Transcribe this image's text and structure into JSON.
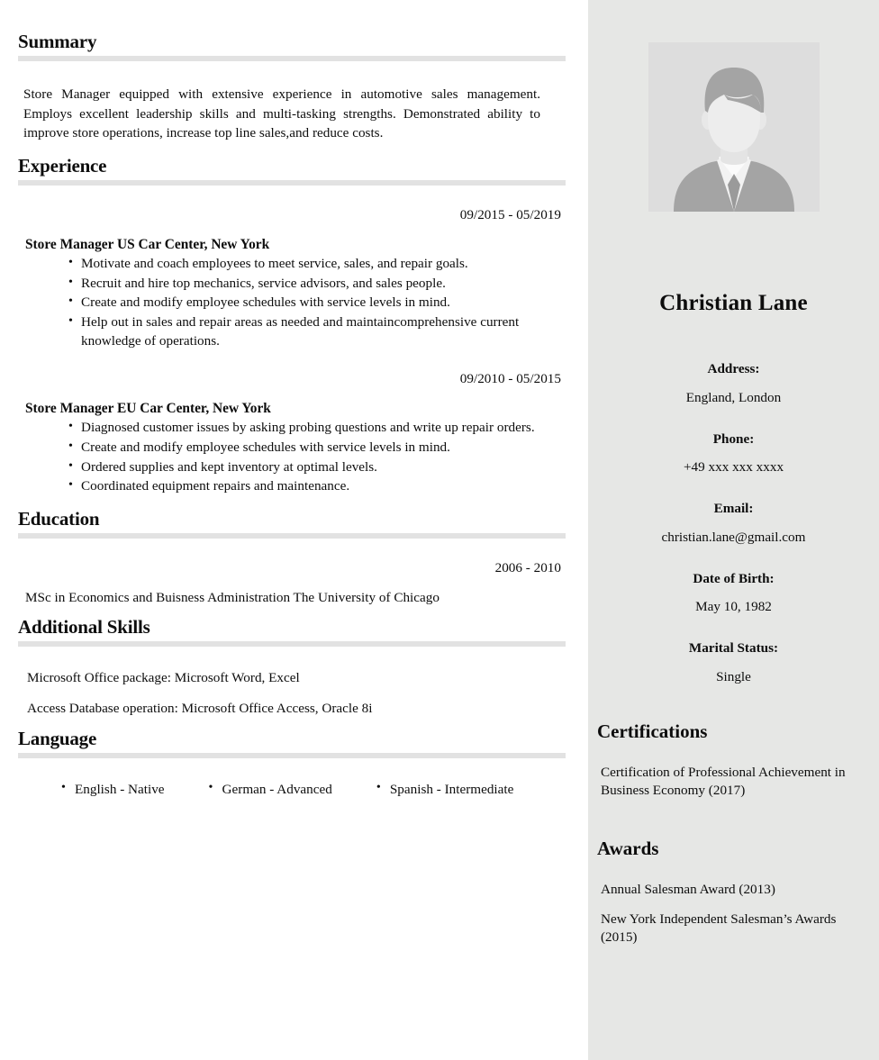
{
  "document": {
    "type": "resume",
    "colors": {
      "page_background": "#ffffff",
      "sidebar_background": "#e6e7e5",
      "rule": "#e2e2e2",
      "text": "#0d0d0d",
      "photo_background": "#dddddd",
      "photo_silhouette": "#a4a4a4",
      "photo_face": "#ededed"
    }
  },
  "main": {
    "summary": {
      "heading": "Summary",
      "text": "Store Manager equipped with extensive experience in automotive sales management. Employs excellent leadership skills and multi-tasking strengths. Demonstrated ability to improve store operations, increase top line sales,and reduce costs."
    },
    "experience": {
      "heading": "Experience",
      "jobs": [
        {
          "dates": "09/2015 - 05/2019",
          "title": "Store Manager US Car Center, New York",
          "bullets": [
            "Motivate and coach employees to meet service, sales, and repair goals.",
            "Recruit and hire top mechanics, service advisors, and sales people.",
            "Create and modify employee schedules with service levels in mind.",
            "Help out in sales and repair areas as needed and maintaincomprehensive current knowledge of operations."
          ]
        },
        {
          "dates": "09/2010 - 05/2015",
          "title": "Store Manager EU Car Center, New York",
          "bullets": [
            "Diagnosed customer issues by asking probing questions and write up repair orders.",
            "Create and modify employee schedules with service levels in mind.",
            "Ordered supplies and kept inventory at optimal levels.",
            "Coordinated equipment repairs and maintenance."
          ]
        }
      ]
    },
    "education": {
      "heading": "Education",
      "dates": "2006 - 2010",
      "degree": "MSc in Economics and Buisness Administration The University of Chicago"
    },
    "additional_skills": {
      "heading": "Additional Skills",
      "items": [
        "Microsoft Office package: Microsoft Word, Excel",
        "Access Database operation: Microsoft Office Access, Oracle 8i"
      ]
    },
    "language": {
      "heading": "Language",
      "items": [
        "English - Native",
        "German - Advanced",
        "Spanish - Intermediate"
      ]
    }
  },
  "sidebar": {
    "photo": {
      "alt": "profile-photo-placeholder"
    },
    "name": "Christian Lane",
    "fields": [
      {
        "label": "Address:",
        "value": "England, London"
      },
      {
        "label": "Phone:",
        "value": "+49 xxx xxx xxxx"
      },
      {
        "label": "Email:",
        "value": "christian.lane@gmail.com"
      },
      {
        "label": "Date of Birth:",
        "value": "May 10, 1982"
      },
      {
        "label": "Marital Status:",
        "value": "Single"
      }
    ],
    "certifications": {
      "heading": "Certifications",
      "items": [
        "Certification of Professional Achievement in Business Economy (2017)"
      ]
    },
    "awards": {
      "heading": "Awards",
      "items": [
        "Annual Salesman Award (2013)",
        "New York Independent Salesman’s Awards (2015)"
      ]
    }
  }
}
